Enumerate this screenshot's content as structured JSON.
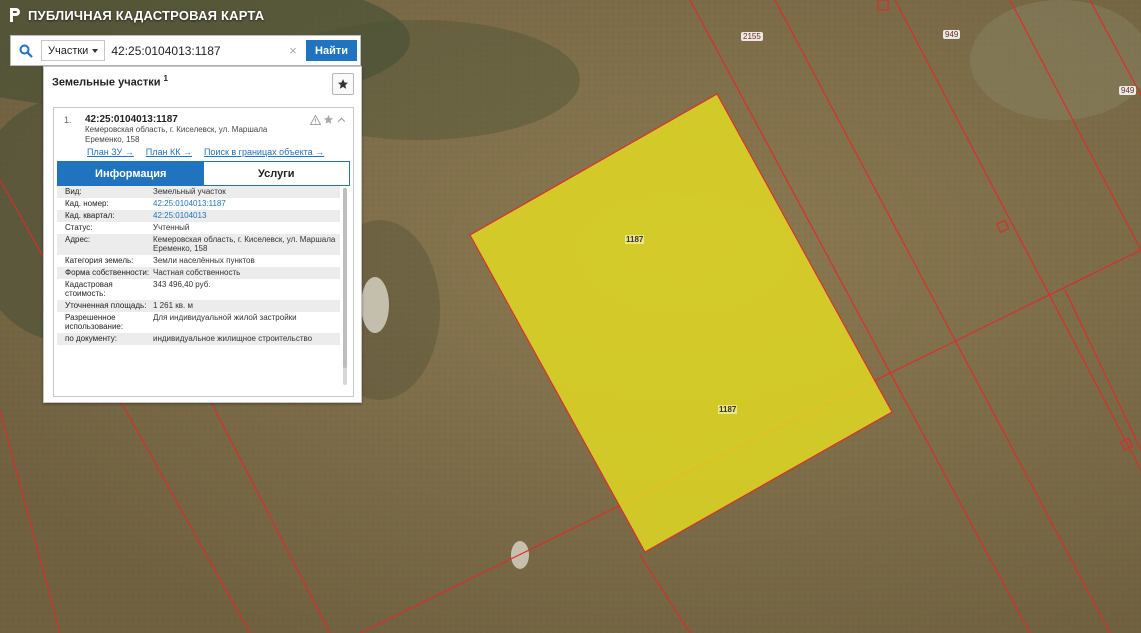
{
  "app": {
    "title": "ПУБЛИЧНАЯ КАДАСТРОВАЯ КАРТА",
    "logo_icon": "rosreestr-logo-icon"
  },
  "search": {
    "type_label": "Участки",
    "value": "42:25:0104013:1187",
    "clear_symbol": "×",
    "button_label": "Найти",
    "search_icon": "search-icon",
    "button_color": "#1f73bf"
  },
  "panel": {
    "header": "Земельные участки",
    "count": "1",
    "favorite_icon": "star-icon",
    "item": {
      "index": "1.",
      "cad_number": "42:25:0104013:1187",
      "address": "Кемеровская область, г. Киселевск, ул. Маршала Еременко, 158",
      "icons": [
        "warning-icon",
        "star-icon",
        "chevron-up-icon"
      ],
      "links": [
        "План ЗУ →",
        "План КК →",
        "Поиск в границах объекта →"
      ],
      "tabs": [
        {
          "label": "Информация",
          "active": true
        },
        {
          "label": "Услуги",
          "active": false
        }
      ],
      "info": [
        {
          "key": "Вид:",
          "value": "Земельный участок",
          "link": false
        },
        {
          "key": "Кад. номер:",
          "value": "42:25:0104013:1187",
          "link": true
        },
        {
          "key": "Кад. квартал:",
          "value": "42:25:0104013",
          "link": true
        },
        {
          "key": "Статус:",
          "value": "Учтенный",
          "link": false
        },
        {
          "key": "Адрес:",
          "value": "Кемеровская область, г. Киселевск, ул. Маршала Еременко, 158",
          "link": false
        },
        {
          "key": "Категория земель:",
          "value": "Земли населённых пунктов",
          "link": false
        },
        {
          "key": "Форма собственности:",
          "value": "Частная собственность",
          "link": false
        },
        {
          "key": "Кадастровая стоимость:",
          "value": "343 496,40 руб.",
          "link": false
        },
        {
          "key": "Уточненная площадь:",
          "value": "1 261 кв. м",
          "link": false
        },
        {
          "key": "Разрешенное использование:",
          "value": "Для индивидуальной жилой застройки",
          "link": false
        },
        {
          "key": "по документу:",
          "value": "индивидуальное жилищное строительство",
          "link": false
        }
      ]
    }
  },
  "map": {
    "labels": [
      "2155",
      "949",
      "949"
    ],
    "plot_labels": [
      "1187",
      "1187"
    ],
    "colors": {
      "boundary": "#e02a2a",
      "selected_fill": "#e6e020",
      "terrain": "#7a6a45"
    }
  }
}
